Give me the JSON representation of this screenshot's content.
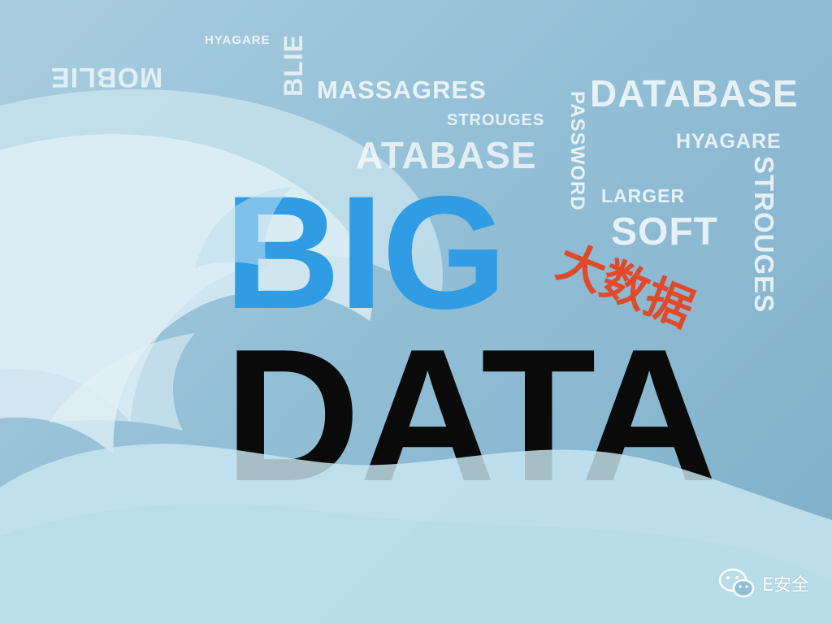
{
  "background": {
    "sky_color": "#93bfd6",
    "wave_color": "#d6ecf3"
  },
  "words": {
    "mobile": "MOBLIE",
    "hyagare_top": "HYAGARE",
    "blie": "BLIE",
    "massagres": "MASSAGRES",
    "strouges_small": "STROUGES",
    "database_right": "DATABASE",
    "password": "PASSWORD",
    "hyagare_right": "HYAGARE",
    "database_mid": "ATABASE",
    "larger": "LARGER",
    "soft": "SOFT",
    "strouges_vertical": "STROUGES"
  },
  "headline": {
    "big": "BIG",
    "data": "DATA",
    "chinese": "大数据",
    "big_color": "#2f9ce4",
    "data_color": "#0a0a0a",
    "chinese_color": "#e04a2a"
  },
  "watermark": {
    "label": "E安全",
    "icon": "wechat-icon"
  }
}
